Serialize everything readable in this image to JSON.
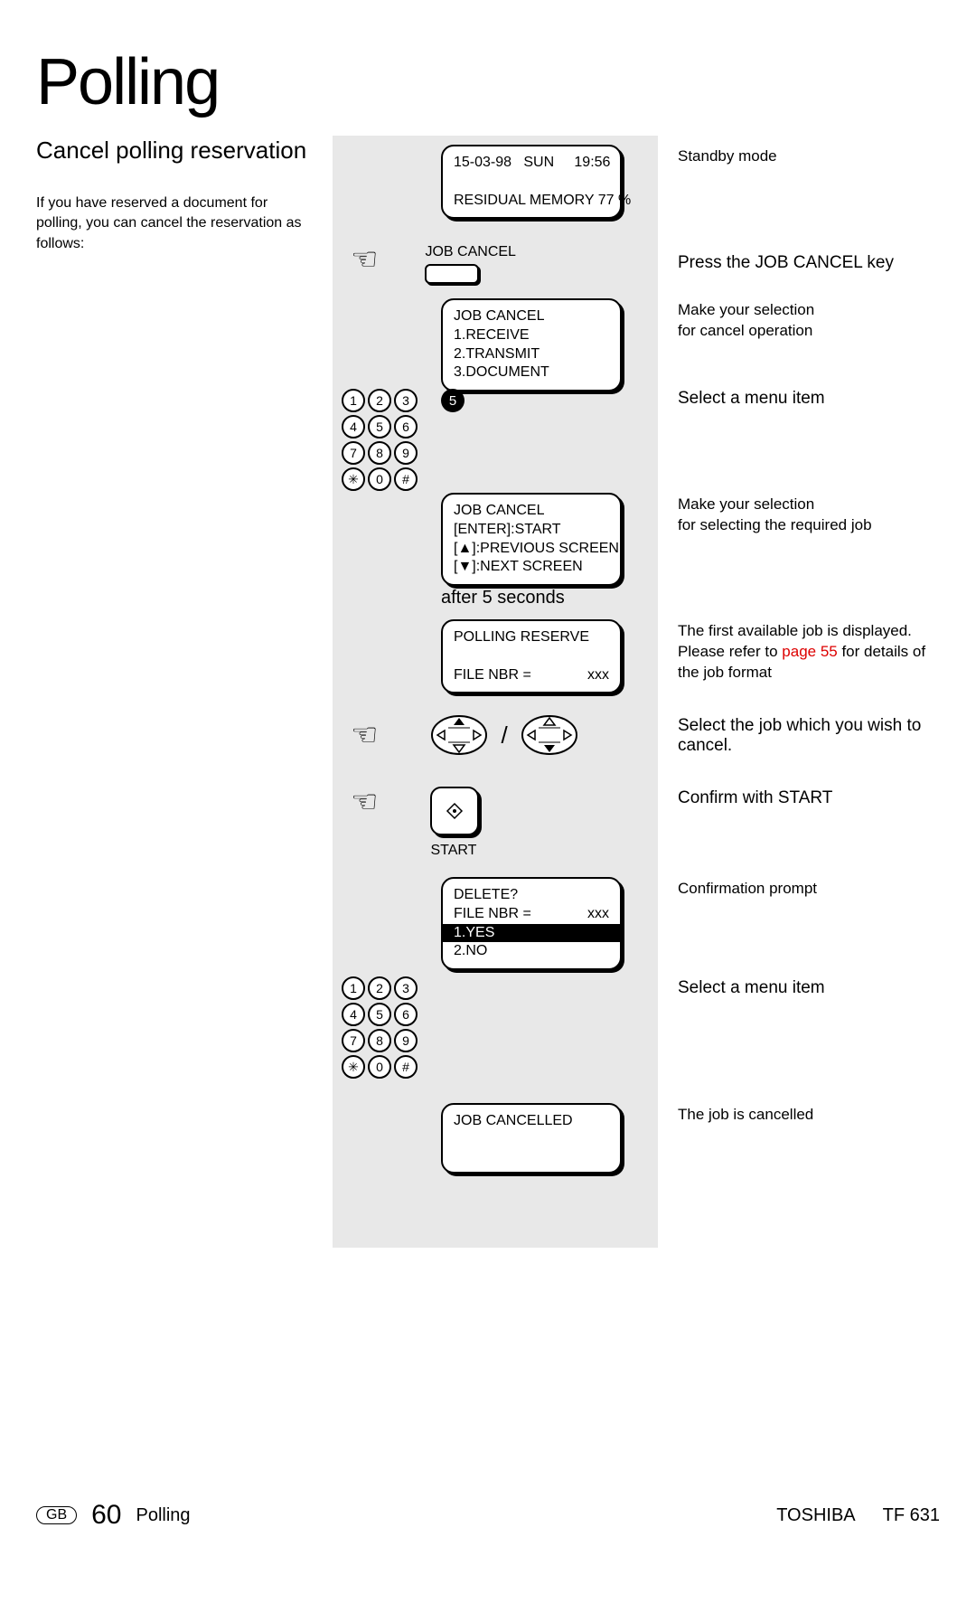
{
  "page_title": "Polling",
  "subtitle": "Cancel polling reserva­tion",
  "intro": "If you have reserved a document for polling, you can cancel the reservation as follows:",
  "lcd_standby": {
    "line1": "15-03-98   SUN     19:56",
    "line2": "",
    "line3": "RESIDUAL MEMORY 77 %"
  },
  "job_cancel_label": "JOB CANCEL",
  "lcd_menu": {
    "line1": "JOB CANCEL",
    "line2": "1.RECEIVE",
    "line3": "2.TRANSMIT",
    "line4": "3.DOCUMENT"
  },
  "keypad": {
    "r1": [
      "1",
      "2",
      "3"
    ],
    "r2": [
      "4",
      "5",
      "6"
    ],
    "r3": [
      "7",
      "8",
      "9"
    ],
    "r4": [
      "✳",
      "0",
      "#"
    ]
  },
  "selected_key": "5",
  "lcd_jobcancel": {
    "line1": "JOB CANCEL",
    "line2": "[ENTER]:START",
    "line3": "[▲]:PREVIOUS SCREEN",
    "line4": "[▼]:NEXT SCREEN"
  },
  "after_text": "after 5 seconds",
  "lcd_polling_reserve": {
    "line1": "POLLING RESERVE",
    "line2": "",
    "line3_left": "FILE NBR =",
    "line3_right": "xxx"
  },
  "start_label": "START",
  "lcd_delete": {
    "line1": "DELETE?",
    "line2_left": "FILE NBR =",
    "line2_right": "xxx",
    "line3": "1.YES",
    "line4": "2.NO"
  },
  "lcd_cancelled": "JOB CANCELLED",
  "right": {
    "r1": "Standby mode",
    "r2": "Press the JOB CANCEL key",
    "r3a": "Make your selection",
    "r3b": "for cancel operation",
    "r4": "Select a menu item",
    "r5a": "Make your selection",
    "r5b": "for selecting the required job",
    "r6a": "The first available job is displayed.",
    "r6b_pre": "Please refer to ",
    "r6b_link": "page 55",
    "r6b_post": " for details of the job format",
    "r7": "Select the job which you wish to cancel.",
    "r8": "Confirm with START",
    "r9": "Confirmation prompt",
    "r10": "Select a menu item",
    "r11": "The job is cancelled"
  },
  "footer": {
    "gb": "GB",
    "page_number": "60",
    "section": "Polling",
    "brand": "TOSHIBA",
    "model": "TF 631"
  }
}
